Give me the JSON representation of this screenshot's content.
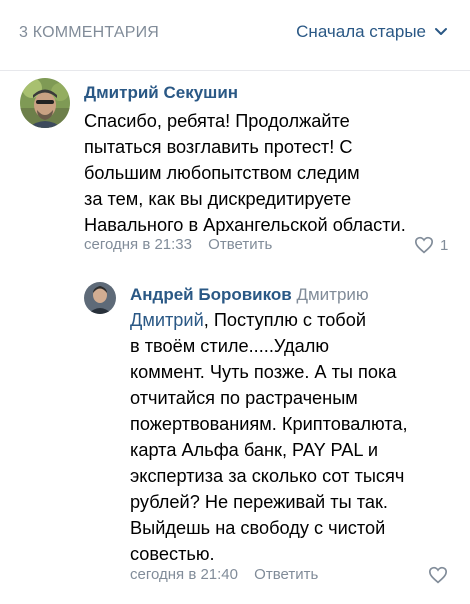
{
  "header": {
    "count_label": "3 КОММЕНТАРИЯ",
    "sort_label": "Сначала старые",
    "sort_icon": "chevron-down-icon"
  },
  "comments": [
    {
      "author": "Дмитрий Секушин",
      "lines": [
        "Спасибо, ребята! Продолжайте",
        "пытаться возглавить протест! С",
        "большим любопытством следим",
        "за тем, как вы дискредитируете",
        "Навального в Архангельской области."
      ],
      "time": "сегодня в 21:33",
      "reply_label": "Ответить",
      "likes": "1"
    },
    {
      "author": "Андрей Боровиков",
      "reply_to": "Дмитрию",
      "mention": "Дмитрий",
      "first_line_rest": ", Поступлю с тобой",
      "lines": [
        "в твоём стиле.....Удалю",
        "коммент. Чуть позже. А ты пока",
        "отчитайся по растраченым",
        "пожертвованиям. Криптовалюта,",
        "карта Альфа банк, PAY PAL и",
        "экспертиза за сколько сот тысяч",
        "рублей? Не переживай ты так.",
        "Выйдешь на свободу с чистой",
        "совестью."
      ],
      "time": "сегодня в 21:40",
      "reply_label": "Ответить"
    }
  ],
  "colors": {
    "link": "#2a5885",
    "secondary": "#818c99",
    "divider": "#e7e8ec"
  }
}
